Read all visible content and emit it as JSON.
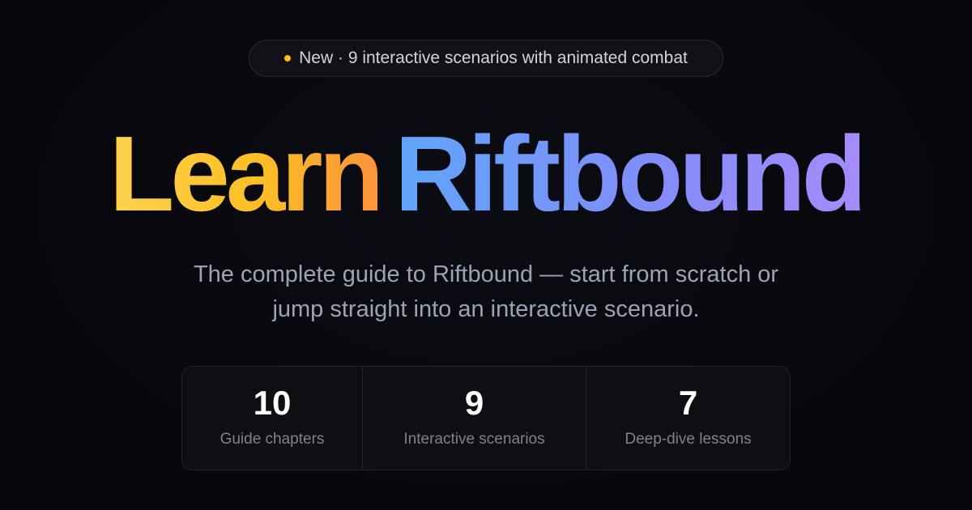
{
  "badge": {
    "text": "New · 9 interactive scenarios with animated combat",
    "dot_color": "#fbbf24"
  },
  "hero": {
    "title_part1": "Learn",
    "title_part2": "Riftbound",
    "subtitle_line1": "The complete guide to Riftbound — start from scratch or",
    "subtitle_line2": "jump straight into an interactive scenario."
  },
  "stats": [
    {
      "value": "10",
      "label": "Guide chapters"
    },
    {
      "value": "9",
      "label": "Interactive scenarios"
    },
    {
      "value": "7",
      "label": "Deep-dive lessons"
    }
  ],
  "colors": {
    "background": "#07070c",
    "learn_gradient": [
      "#fcd34d",
      "#fb923c"
    ],
    "riftbound_gradient": [
      "#60a5fa",
      "#a78bfa"
    ]
  }
}
